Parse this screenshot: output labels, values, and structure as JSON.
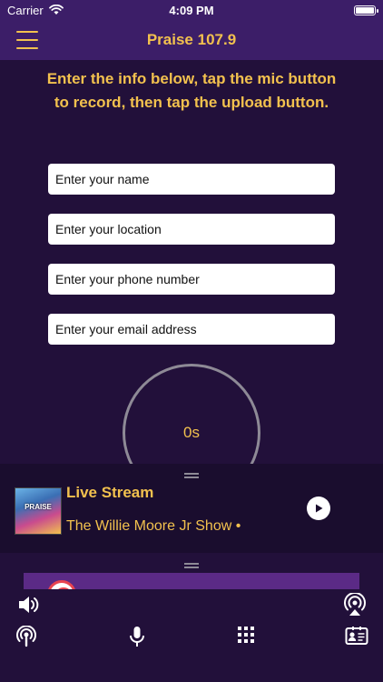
{
  "status_bar": {
    "carrier": "Carrier",
    "time": "4:09 PM"
  },
  "nav": {
    "title": "Praise 107.9",
    "menu_icon": "hamburger-menu-icon"
  },
  "form": {
    "instructions": "Enter the info below, tap the mic button to record, then tap the upload button.",
    "name_placeholder": "Enter your name",
    "location_placeholder": "Enter your location",
    "phone_placeholder": "Enter your phone number",
    "email_placeholder": "Enter your email address"
  },
  "recorder": {
    "timer": "0s"
  },
  "player": {
    "title": "Live Stream",
    "subtitle": "The Willie Moore Jr Show •",
    "album_art_text": "PRAISE"
  },
  "colors": {
    "accent": "#f2c14e",
    "nav_background": "#3c1e68",
    "page_background": "#22103a",
    "player_background": "#1a0d2e"
  },
  "icons": {
    "volume": "speaker-volume-icon",
    "airplay": "airplay-icon",
    "podcast": "podcast-icon",
    "mic": "microphone-icon",
    "grid": "grid-menu-icon",
    "contact": "contact-card-icon"
  }
}
